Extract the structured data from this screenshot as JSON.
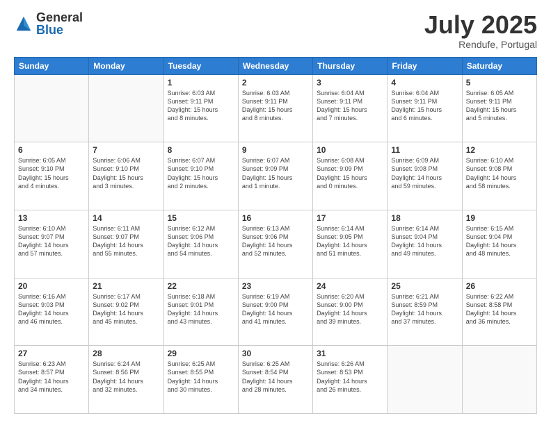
{
  "logo": {
    "general": "General",
    "blue": "Blue"
  },
  "title": "July 2025",
  "subtitle": "Rendufe, Portugal",
  "days_header": [
    "Sunday",
    "Monday",
    "Tuesday",
    "Wednesday",
    "Thursday",
    "Friday",
    "Saturday"
  ],
  "weeks": [
    [
      {
        "day": "",
        "info": ""
      },
      {
        "day": "",
        "info": ""
      },
      {
        "day": "1",
        "info": "Sunrise: 6:03 AM\nSunset: 9:11 PM\nDaylight: 15 hours\nand 8 minutes."
      },
      {
        "day": "2",
        "info": "Sunrise: 6:03 AM\nSunset: 9:11 PM\nDaylight: 15 hours\nand 8 minutes."
      },
      {
        "day": "3",
        "info": "Sunrise: 6:04 AM\nSunset: 9:11 PM\nDaylight: 15 hours\nand 7 minutes."
      },
      {
        "day": "4",
        "info": "Sunrise: 6:04 AM\nSunset: 9:11 PM\nDaylight: 15 hours\nand 6 minutes."
      },
      {
        "day": "5",
        "info": "Sunrise: 6:05 AM\nSunset: 9:11 PM\nDaylight: 15 hours\nand 5 minutes."
      }
    ],
    [
      {
        "day": "6",
        "info": "Sunrise: 6:05 AM\nSunset: 9:10 PM\nDaylight: 15 hours\nand 4 minutes."
      },
      {
        "day": "7",
        "info": "Sunrise: 6:06 AM\nSunset: 9:10 PM\nDaylight: 15 hours\nand 3 minutes."
      },
      {
        "day": "8",
        "info": "Sunrise: 6:07 AM\nSunset: 9:10 PM\nDaylight: 15 hours\nand 2 minutes."
      },
      {
        "day": "9",
        "info": "Sunrise: 6:07 AM\nSunset: 9:09 PM\nDaylight: 15 hours\nand 1 minute."
      },
      {
        "day": "10",
        "info": "Sunrise: 6:08 AM\nSunset: 9:09 PM\nDaylight: 15 hours\nand 0 minutes."
      },
      {
        "day": "11",
        "info": "Sunrise: 6:09 AM\nSunset: 9:08 PM\nDaylight: 14 hours\nand 59 minutes."
      },
      {
        "day": "12",
        "info": "Sunrise: 6:10 AM\nSunset: 9:08 PM\nDaylight: 14 hours\nand 58 minutes."
      }
    ],
    [
      {
        "day": "13",
        "info": "Sunrise: 6:10 AM\nSunset: 9:07 PM\nDaylight: 14 hours\nand 57 minutes."
      },
      {
        "day": "14",
        "info": "Sunrise: 6:11 AM\nSunset: 9:07 PM\nDaylight: 14 hours\nand 55 minutes."
      },
      {
        "day": "15",
        "info": "Sunrise: 6:12 AM\nSunset: 9:06 PM\nDaylight: 14 hours\nand 54 minutes."
      },
      {
        "day": "16",
        "info": "Sunrise: 6:13 AM\nSunset: 9:06 PM\nDaylight: 14 hours\nand 52 minutes."
      },
      {
        "day": "17",
        "info": "Sunrise: 6:14 AM\nSunset: 9:05 PM\nDaylight: 14 hours\nand 51 minutes."
      },
      {
        "day": "18",
        "info": "Sunrise: 6:14 AM\nSunset: 9:04 PM\nDaylight: 14 hours\nand 49 minutes."
      },
      {
        "day": "19",
        "info": "Sunrise: 6:15 AM\nSunset: 9:04 PM\nDaylight: 14 hours\nand 48 minutes."
      }
    ],
    [
      {
        "day": "20",
        "info": "Sunrise: 6:16 AM\nSunset: 9:03 PM\nDaylight: 14 hours\nand 46 minutes."
      },
      {
        "day": "21",
        "info": "Sunrise: 6:17 AM\nSunset: 9:02 PM\nDaylight: 14 hours\nand 45 minutes."
      },
      {
        "day": "22",
        "info": "Sunrise: 6:18 AM\nSunset: 9:01 PM\nDaylight: 14 hours\nand 43 minutes."
      },
      {
        "day": "23",
        "info": "Sunrise: 6:19 AM\nSunset: 9:00 PM\nDaylight: 14 hours\nand 41 minutes."
      },
      {
        "day": "24",
        "info": "Sunrise: 6:20 AM\nSunset: 9:00 PM\nDaylight: 14 hours\nand 39 minutes."
      },
      {
        "day": "25",
        "info": "Sunrise: 6:21 AM\nSunset: 8:59 PM\nDaylight: 14 hours\nand 37 minutes."
      },
      {
        "day": "26",
        "info": "Sunrise: 6:22 AM\nSunset: 8:58 PM\nDaylight: 14 hours\nand 36 minutes."
      }
    ],
    [
      {
        "day": "27",
        "info": "Sunrise: 6:23 AM\nSunset: 8:57 PM\nDaylight: 14 hours\nand 34 minutes."
      },
      {
        "day": "28",
        "info": "Sunrise: 6:24 AM\nSunset: 8:56 PM\nDaylight: 14 hours\nand 32 minutes."
      },
      {
        "day": "29",
        "info": "Sunrise: 6:25 AM\nSunset: 8:55 PM\nDaylight: 14 hours\nand 30 minutes."
      },
      {
        "day": "30",
        "info": "Sunrise: 6:25 AM\nSunset: 8:54 PM\nDaylight: 14 hours\nand 28 minutes."
      },
      {
        "day": "31",
        "info": "Sunrise: 6:26 AM\nSunset: 8:53 PM\nDaylight: 14 hours\nand 26 minutes."
      },
      {
        "day": "",
        "info": ""
      },
      {
        "day": "",
        "info": ""
      }
    ]
  ]
}
